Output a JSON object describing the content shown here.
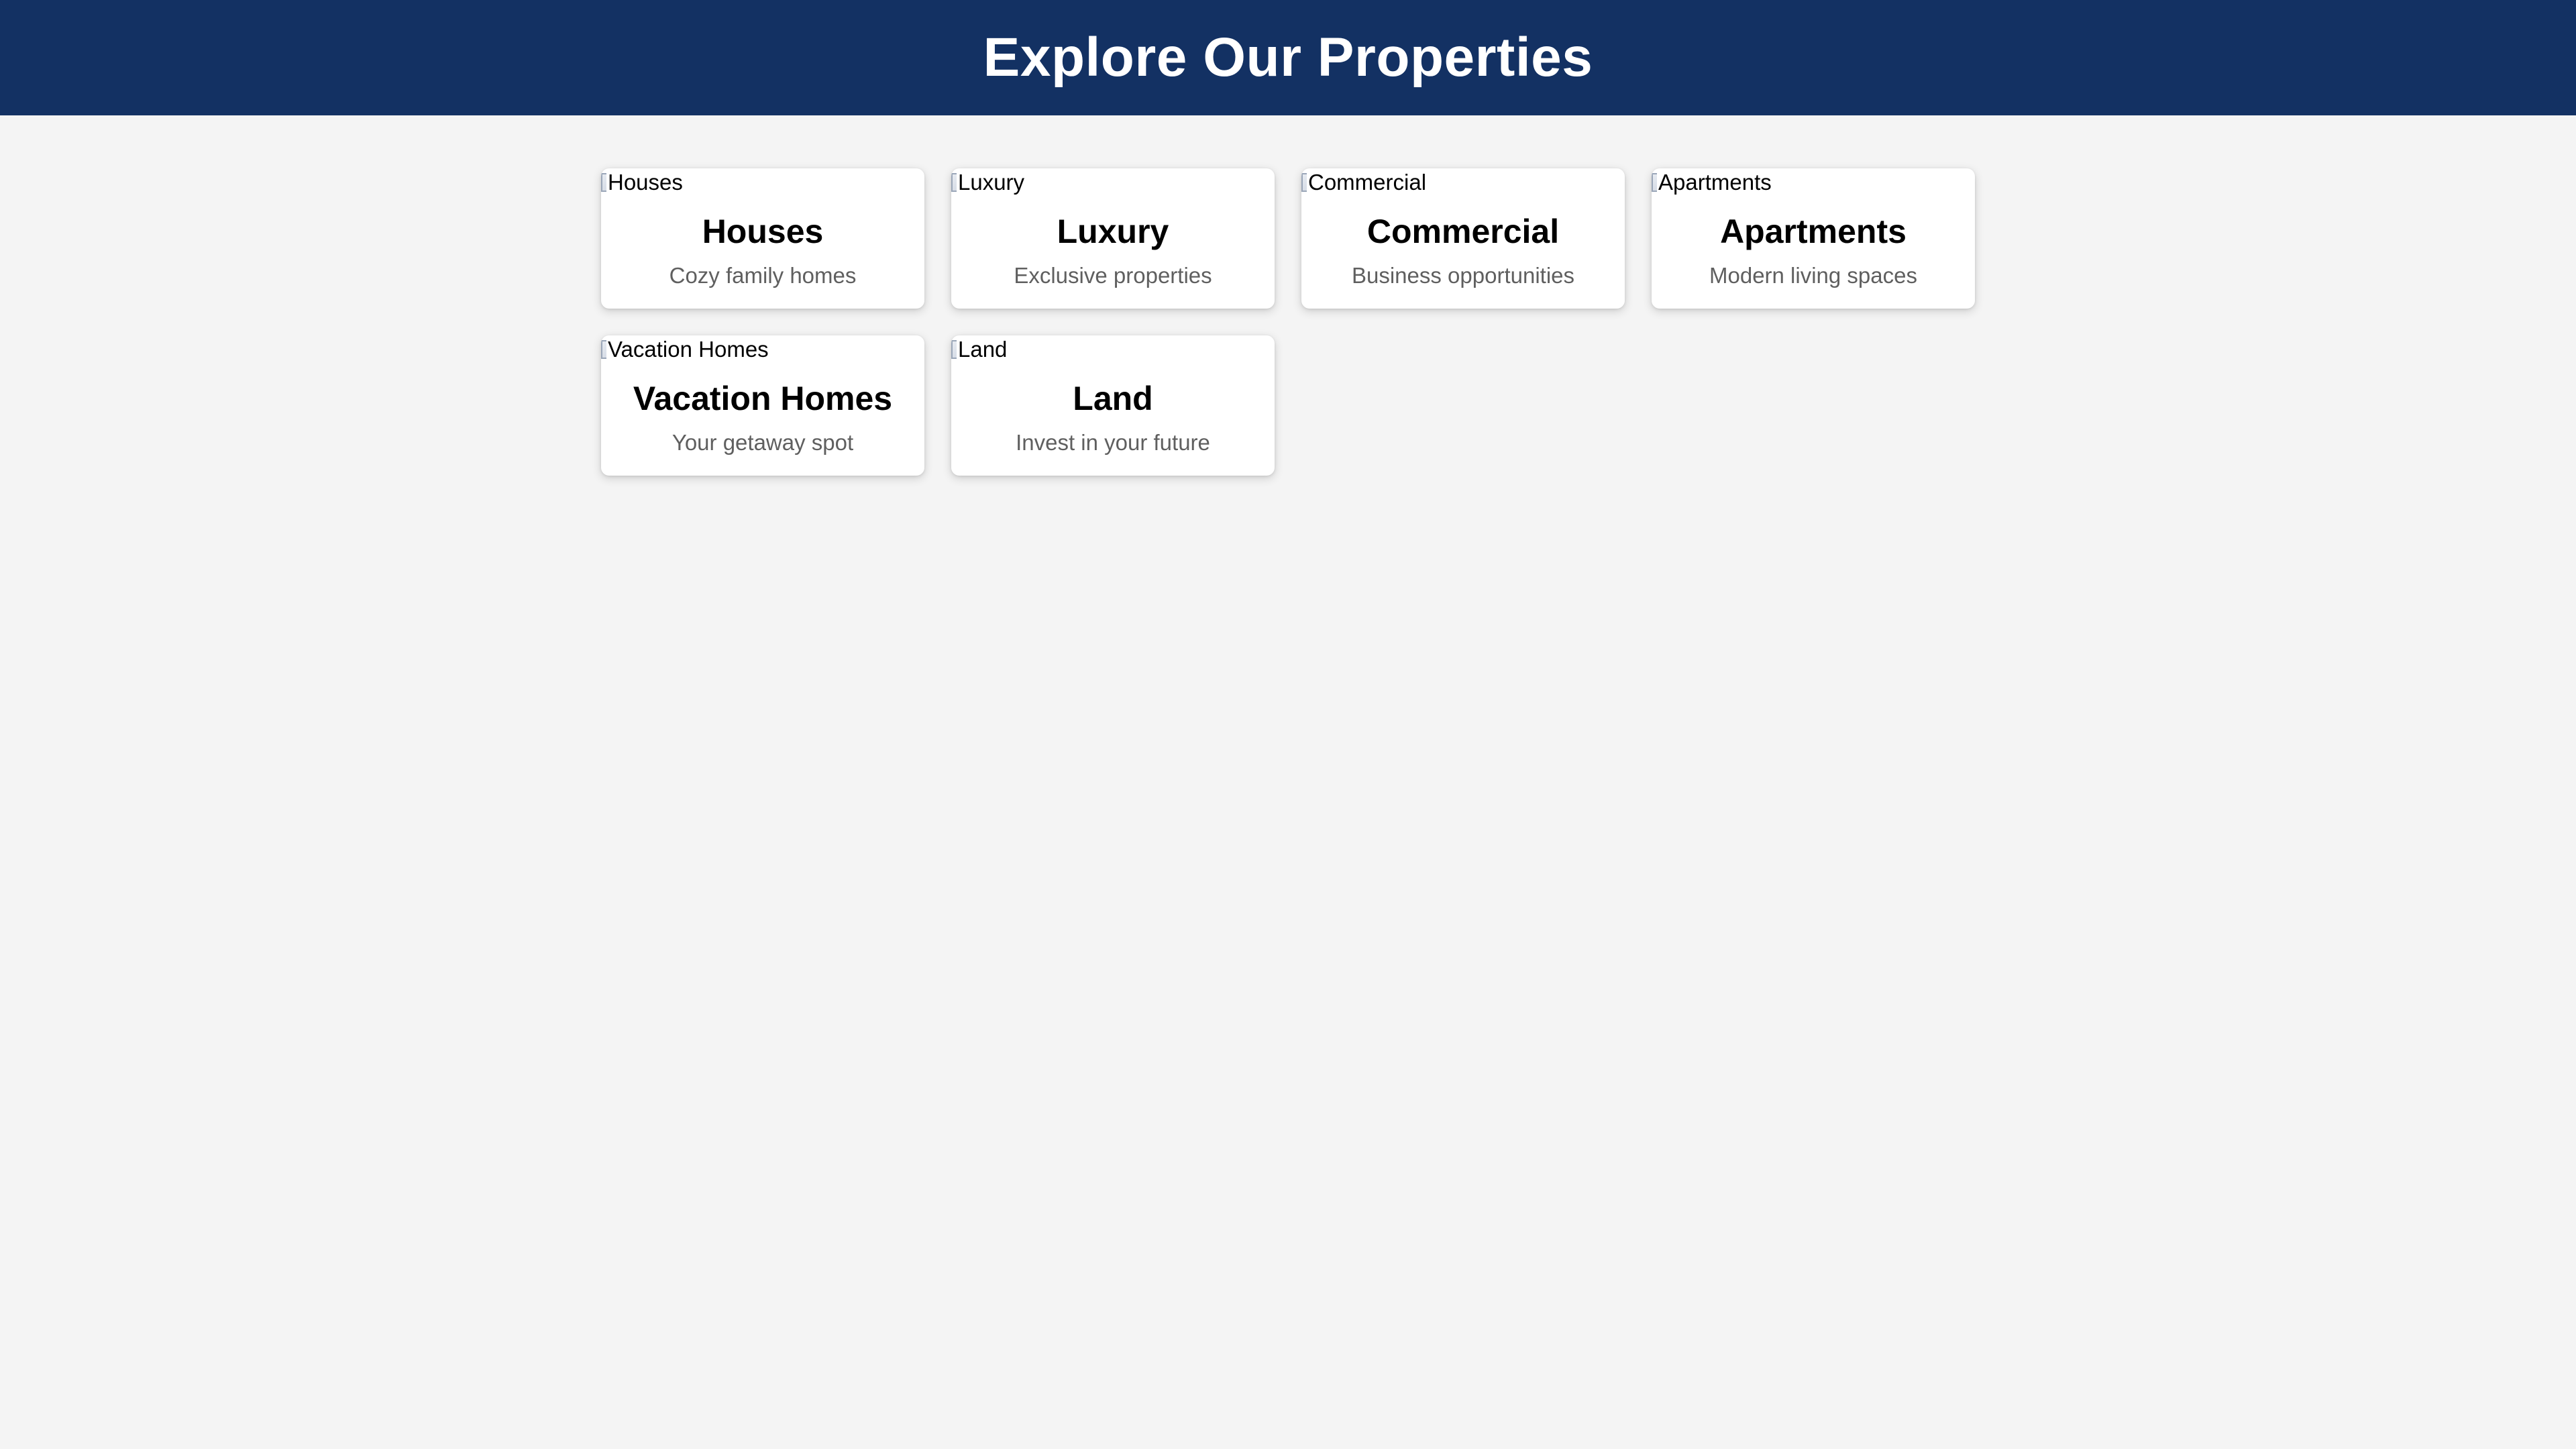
{
  "header": {
    "title": "Explore Our Properties"
  },
  "colors": {
    "header_bg": "#133163",
    "page_bg": "#f4f4f4",
    "card_bg": "#ffffff",
    "desc_text": "#5f5f5f"
  },
  "cards": [
    {
      "alt": "Houses",
      "title": "Houses",
      "description": "Cozy family homes",
      "icon": "broken-image-icon"
    },
    {
      "alt": "Luxury",
      "title": "Luxury",
      "description": "Exclusive properties",
      "icon": "broken-image-icon"
    },
    {
      "alt": "Commercial",
      "title": "Commercial",
      "description": "Business opportunities",
      "icon": "broken-image-icon"
    },
    {
      "alt": "Apartments",
      "title": "Apartments",
      "description": "Modern living spaces",
      "icon": "broken-image-icon"
    },
    {
      "alt": "Vacation Homes",
      "title": "Vacation Homes",
      "description": "Your getaway spot",
      "icon": "broken-image-icon"
    },
    {
      "alt": "Land",
      "title": "Land",
      "description": "Invest in your future",
      "icon": "broken-image-icon"
    }
  ]
}
